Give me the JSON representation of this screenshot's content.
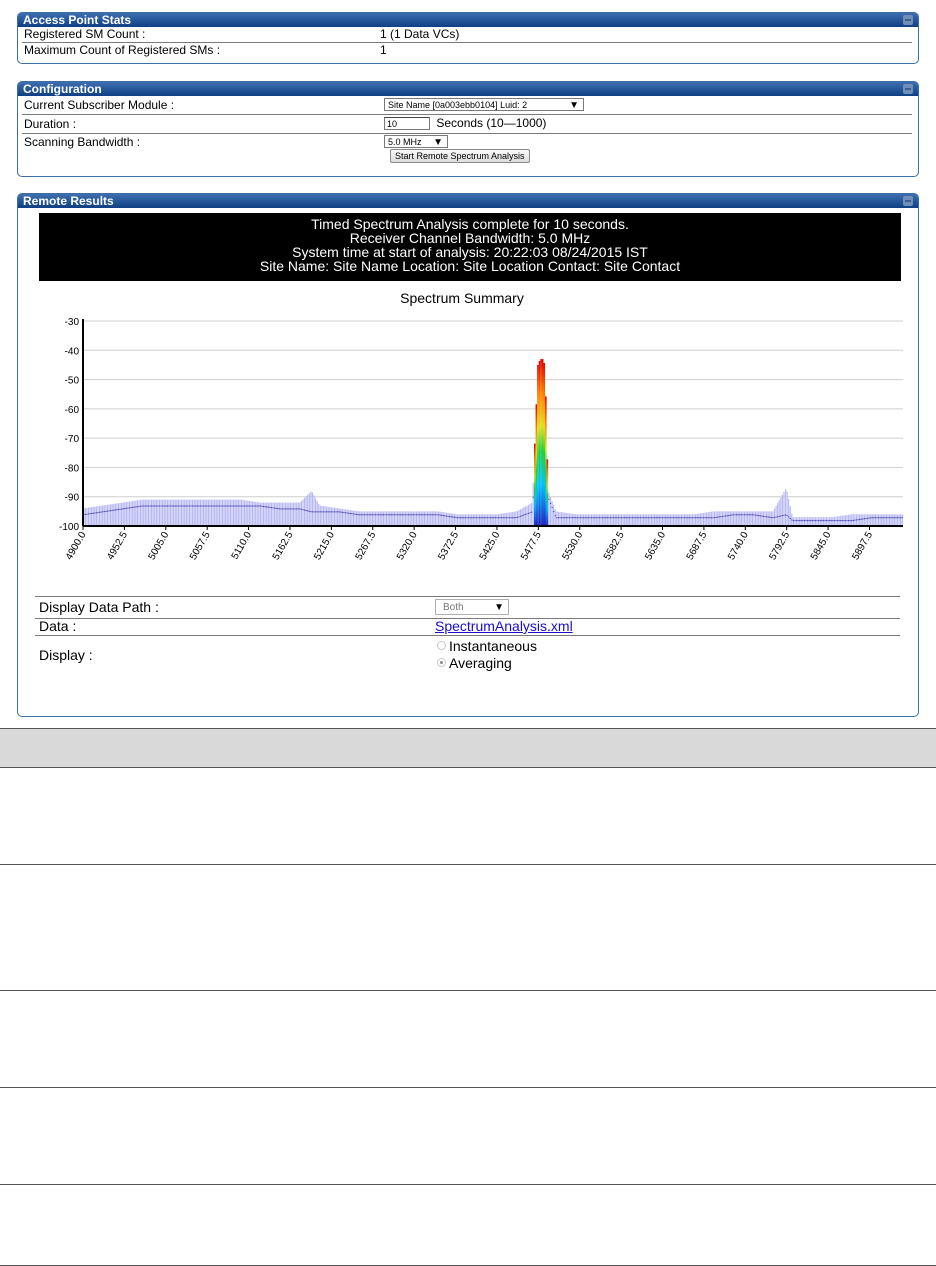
{
  "ap_stats": {
    "title": "Access Point Stats",
    "rows": [
      {
        "label": "Registered SM Count :",
        "value": "1 (1 Data VCs)"
      },
      {
        "label": "Maximum Count of Registered SMs :",
        "value": "1"
      }
    ]
  },
  "configuration": {
    "title": "Configuration",
    "current_sm_label": "Current Subscriber Module :",
    "current_sm_value": "Site Name [0a003ebb0104] Luid: 2",
    "duration_label": "Duration :",
    "duration_value": "10",
    "duration_hint": "Seconds (10—1000)",
    "bandwidth_label": "Scanning Bandwidth :",
    "bandwidth_value": "5.0 MHz",
    "start_button": "Start Remote Spectrum Analysis",
    "dropdown_arrow": "▼"
  },
  "remote_results": {
    "title": "Remote Results",
    "banner": [
      "Timed Spectrum Analysis complete for 10 seconds.",
      "Receiver Channel Bandwidth: 5.0 MHz",
      "System time at start of analysis: 20:22:03 08/24/2015 IST",
      "Site Name: Site Name  Location: Site Location  Contact: Site Contact"
    ],
    "display_path_label": "Display Data Path :",
    "display_path_value": "Both",
    "data_label": "Data :",
    "data_link": "SpectrumAnalysis.xml",
    "display_label": "Display :",
    "display_options": [
      "Instantaneous",
      "Averaging"
    ],
    "display_selected": "Averaging"
  },
  "chart_data": {
    "type": "bar",
    "title": "Spectrum Summary",
    "x_ticks": [
      "4900.0",
      "4952.5",
      "5005.0",
      "5057.5",
      "5110.0",
      "5162.5",
      "5215.0",
      "5267.5",
      "5320.0",
      "5372.5",
      "5425.0",
      "5477.5",
      "5530.0",
      "5582.5",
      "5635.0",
      "5687.5",
      "5740.0",
      "5792.5",
      "5845.0",
      "5897.5"
    ],
    "y_ticks": [
      "-30",
      "-40",
      "-50",
      "-60",
      "-70",
      "-80",
      "-90",
      "-100"
    ],
    "xlim": [
      4900.0,
      5940.0
    ],
    "ylim": [
      -100,
      -30
    ],
    "grid": true,
    "series": [
      {
        "x": [
          4900,
          4925,
          4950,
          4975,
          5000,
          5025,
          5050,
          5075,
          5100,
          5125,
          5150,
          5175,
          5190,
          5200,
          5225,
          5250,
          5275,
          5300,
          5325,
          5350,
          5375,
          5400,
          5425,
          5450,
          5470,
          5477,
          5480,
          5483,
          5486,
          5490,
          5500,
          5525,
          5550,
          5575,
          5600,
          5625,
          5650,
          5675,
          5700,
          5725,
          5750,
          5775,
          5792,
          5800,
          5825,
          5850,
          5875,
          5900,
          5925,
          5940
        ],
        "avg": [
          -96,
          -95,
          -94,
          -93,
          -93,
          -93,
          -93,
          -93,
          -93,
          -93,
          -94,
          -94,
          -95,
          -95,
          -95,
          -96,
          -96,
          -96,
          -96,
          -96,
          -97,
          -97,
          -97,
          -97,
          -95,
          -60,
          -45,
          -44,
          -50,
          -90,
          -97,
          -97,
          -97,
          -97,
          -97,
          -97,
          -97,
          -97,
          -97,
          -96,
          -96,
          -97,
          -96,
          -98,
          -98,
          -98,
          -98,
          -97,
          -97,
          -97
        ],
        "peak": [
          -94,
          -93,
          -92,
          -91,
          -91,
          -91,
          -91,
          -91,
          -91,
          -92,
          -92,
          -92,
          -88,
          -93,
          -94,
          -95,
          -95,
          -95,
          -95,
          -95,
          -96,
          -96,
          -96,
          -95,
          -92,
          -45,
          -43,
          -43,
          -45,
          -88,
          -95,
          -96,
          -96,
          -96,
          -96,
          -96,
          -96,
          -96,
          -95,
          -95,
          -95,
          -95,
          -87,
          -97,
          -97,
          -97,
          -96,
          -96,
          -96,
          -96
        ]
      }
    ]
  }
}
